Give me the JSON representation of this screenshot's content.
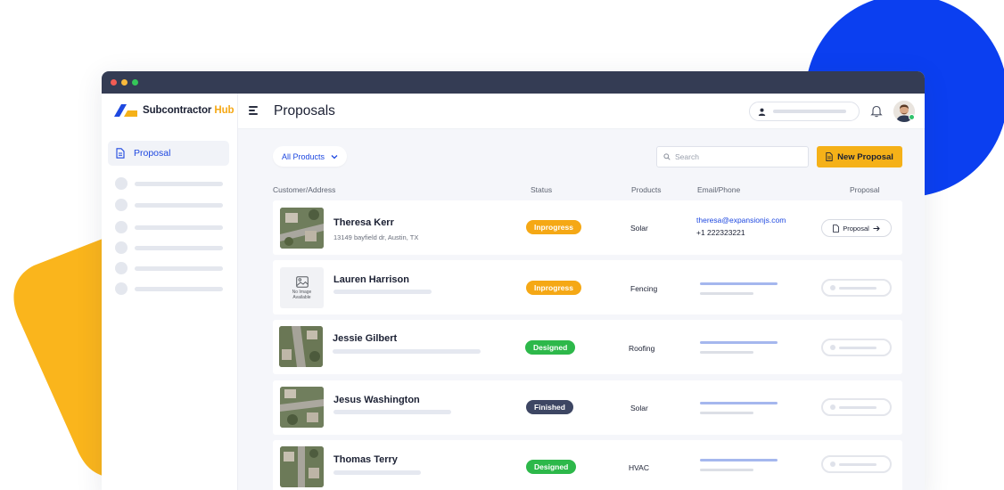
{
  "app": {
    "name_main": "Subcontractor",
    "name_accent": "Hub"
  },
  "colors": {
    "brand_blue": "#1e48e0",
    "brand_yellow": "#f5b118",
    "inprogress": "#f5a815",
    "designed": "#2db84a",
    "finished": "#3d4663"
  },
  "sidebar": {
    "active_item": {
      "label": "Proposal",
      "icon": "document-icon"
    }
  },
  "header": {
    "title": "Proposals"
  },
  "toolbar": {
    "filter_label": "All Products",
    "search_placeholder": "Search",
    "new_button_label": "New Proposal"
  },
  "table": {
    "columns": [
      "Customer/Address",
      "Status",
      "Products",
      "Email/Phone",
      "Proposal"
    ],
    "rows": [
      {
        "name": "Theresa Kerr",
        "address": "13149 bayfield dr, Austin, TX",
        "status": "Inprogress",
        "product": "Solar",
        "email": "theresa@expansionjs.com",
        "phone": "+1 222323221",
        "proposal_label": "Proposal"
      },
      {
        "name": "Lauren Harrison",
        "status": "Inprogress",
        "product": "Fencing",
        "no_image_caption_1": "No Image",
        "no_image_caption_2": "Available"
      },
      {
        "name": "Jessie Gilbert",
        "status": "Designed",
        "product": "Roofing"
      },
      {
        "name": "Jesus Washington",
        "status": "Finished",
        "product": "Solar"
      },
      {
        "name": "Thomas Terry",
        "status": "Designed",
        "product": "HVAC"
      }
    ]
  }
}
